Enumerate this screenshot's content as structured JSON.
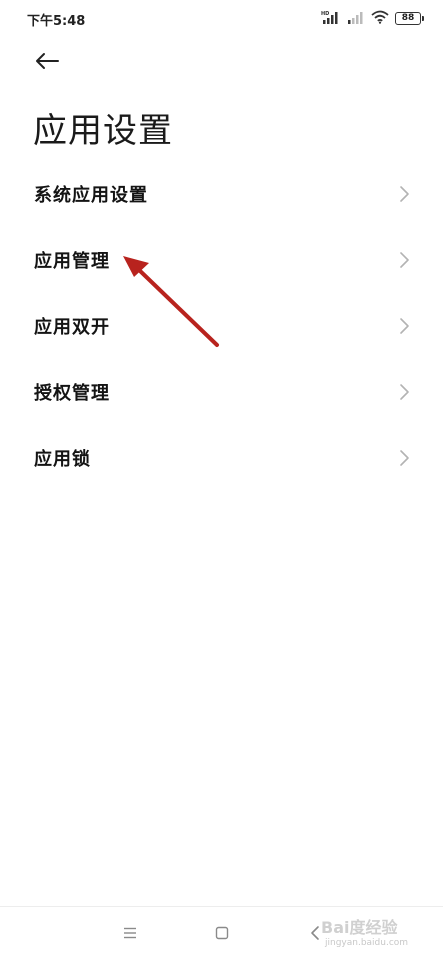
{
  "status_bar": {
    "time": "下午5:48",
    "battery_level": "88",
    "icons": [
      "hd-signal-icon",
      "signal-icon",
      "wifi-icon",
      "battery-icon"
    ]
  },
  "header": {
    "back_icon": "back-arrow-icon",
    "title": "应用设置"
  },
  "settings": {
    "items": [
      {
        "label": "系统应用设置",
        "icon": "chevron-right-icon"
      },
      {
        "label": "应用管理",
        "icon": "chevron-right-icon"
      },
      {
        "label": "应用双开",
        "icon": "chevron-right-icon"
      },
      {
        "label": "授权管理",
        "icon": "chevron-right-icon"
      },
      {
        "label": "应用锁",
        "icon": "chevron-right-icon"
      }
    ]
  },
  "annotation": {
    "color": "#b8231e",
    "points_to": "应用管理"
  },
  "nav_bar": {
    "icons": [
      "menu-icon",
      "home-icon",
      "back-icon"
    ]
  },
  "watermark": {
    "main": "Bai度经验",
    "sub": "jingyan.baidu.com"
  }
}
